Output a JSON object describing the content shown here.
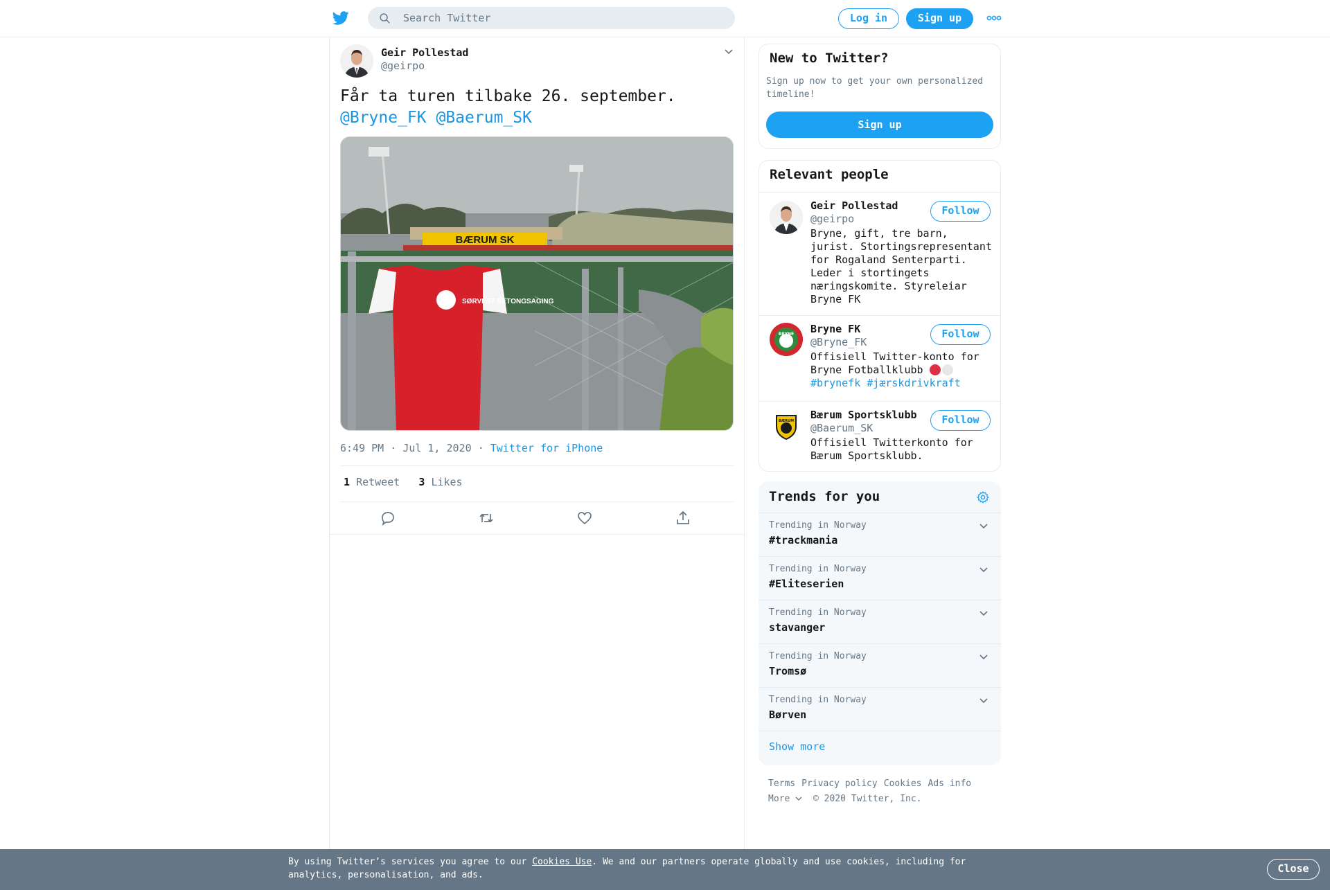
{
  "header": {
    "search_placeholder": "Search Twitter",
    "login_label": "Log in",
    "signup_label": "Sign up",
    "logo_icon": "twitter-bird-icon",
    "more_icon": "more-dots-icon"
  },
  "tweet": {
    "author_name": "Geir Pollestad",
    "author_handle": "@geirpo",
    "text": "Får ta turen tilbake 26. september.",
    "mentions": [
      "@Bryne_FK",
      "@Baerum_SK"
    ],
    "time": "6:49 PM",
    "date": "Jul 1, 2020",
    "source": "Twitter for iPhone",
    "retweet_count": "1",
    "retweet_label": "Retweet",
    "like_count": "3",
    "like_label": "Likes",
    "media_sign_text": "BÆRUM SK",
    "shirt_text": "SØRVEST BETONGSAGING"
  },
  "new_to_twitter": {
    "title": "New to Twitter?",
    "subtitle": "Sign up now to get your own personalized timeline!",
    "button": "Sign up"
  },
  "relevant_people": {
    "title": "Relevant people",
    "follow_label": "Follow",
    "people": [
      {
        "name": "Geir Pollestad",
        "handle": "@geirpo",
        "bio": "Bryne, gift, tre barn, jurist. Stortingsrepresentant for Rogaland Senterparti. Leder i stortingets næringskomite. Styreleiar Bryne FK"
      },
      {
        "name": "Bryne FK",
        "handle": "@Bryne_FK",
        "bio": "Offisiell Twitter-konto for Bryne Fotballklubb",
        "bio_tags": "#brynefk #jærskdrivkraft",
        "logo_text": "BRYNE"
      },
      {
        "name": "Bærum Sportsklubb",
        "handle": "@Baerum_SK",
        "bio": "Offisiell Twitterkonto for Bærum Sportsklubb.",
        "logo_text": "BÆRUM"
      }
    ]
  },
  "trends": {
    "title": "Trends for you",
    "items": [
      {
        "context": "Trending in Norway",
        "name": "#trackmania"
      },
      {
        "context": "Trending in Norway",
        "name": "#Eliteserien"
      },
      {
        "context": "Trending in Norway",
        "name": "stavanger"
      },
      {
        "context": "Trending in Norway",
        "name": "Tromsø"
      },
      {
        "context": "Trending in Norway",
        "name": "Børven"
      }
    ],
    "show_more": "Show more"
  },
  "footer": {
    "links": [
      "Terms",
      "Privacy policy",
      "Cookies",
      "Ads info"
    ],
    "more": "More",
    "copyright": "© 2020 Twitter, Inc."
  },
  "cookie_bar": {
    "text_before": "By using Twitter’s services you agree to our ",
    "link": "Cookies Use",
    "text_after": ". We and our partners operate globally and use cookies, including for analytics, personalisation, and ads.",
    "close": "Close"
  },
  "colors": {
    "accent": "#1da1f2",
    "link": "#1b95e0",
    "muted": "#657786",
    "cookie_bar": "#657786",
    "trends_bg": "#f5f8fa"
  }
}
